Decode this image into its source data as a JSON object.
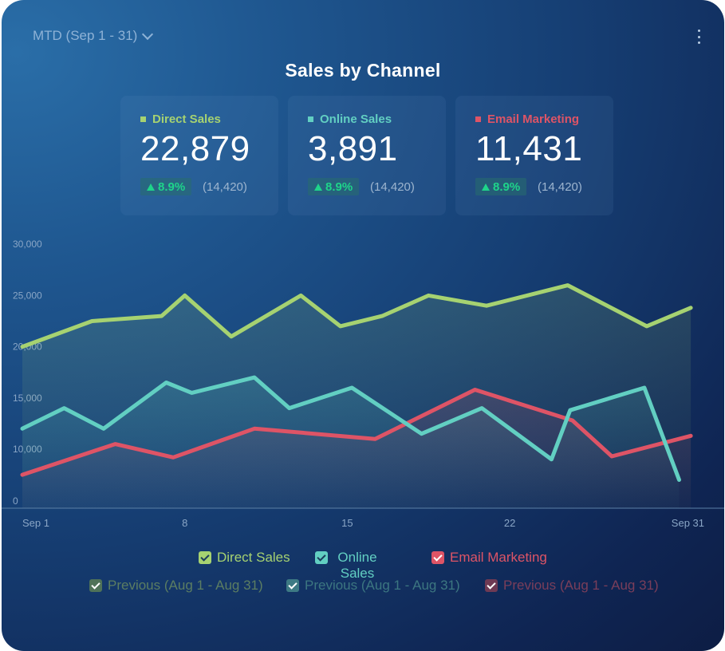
{
  "header": {
    "period_label": "MTD (Sep 1 - 31)",
    "title": "Sales by Channel"
  },
  "colors": {
    "direct": "#a6d271",
    "online": "#62cfc2",
    "email": "#de5466",
    "positive": "#1ed48a"
  },
  "kpis": [
    {
      "label": "Direct Sales",
      "value": "22,879",
      "change": "8.9%",
      "previous": "(14,420)"
    },
    {
      "label": "Online Sales",
      "value": "3,891",
      "change": "8.9%",
      "previous": "(14,420)"
    },
    {
      "label": "Email Marketing",
      "value": "11,431",
      "change": "8.9%",
      "previous": "(14,420)"
    }
  ],
  "legend": {
    "current": [
      "Direct Sales",
      "Online Sales",
      "Email Marketing"
    ],
    "previous": [
      "Previous (Aug 1 - Aug 31)",
      "Previous (Aug 1 - Aug 31)",
      "Previous (Aug 1 - Aug 31)"
    ]
  },
  "chart_data": {
    "type": "line",
    "title": "Sales by Channel",
    "xlabel": "",
    "ylabel": "",
    "x_ticks": [
      "Sep 1",
      "8",
      "15",
      "22",
      "Sep 31"
    ],
    "x_tick_positions": [
      1,
      8,
      15,
      22,
      29
    ],
    "y_ticks": [
      "0",
      "10,000",
      "15,000",
      "20,000",
      "25,000",
      "30,000"
    ],
    "ylim": [
      5000,
      30000
    ],
    "xlim": [
      1,
      29
    ],
    "grid": false,
    "series": [
      {
        "name": "Direct Sales",
        "color": "#a6d271",
        "points": [
          [
            1,
            20000
          ],
          [
            4,
            22500
          ],
          [
            7,
            23000
          ],
          [
            8,
            25000
          ],
          [
            10,
            21000
          ],
          [
            13,
            25000
          ],
          [
            14.7,
            22000
          ],
          [
            16.5,
            23000
          ],
          [
            18.5,
            25000
          ],
          [
            21,
            24000
          ],
          [
            24.5,
            26000
          ],
          [
            27.9,
            22000
          ],
          [
            29.8,
            23800
          ]
        ]
      },
      {
        "name": "Online Sales",
        "color": "#62cfc2",
        "points": [
          [
            1,
            12000
          ],
          [
            2.8,
            14000
          ],
          [
            4.5,
            12000
          ],
          [
            7.2,
            16500
          ],
          [
            8.3,
            15500
          ],
          [
            11,
            17000
          ],
          [
            12.5,
            14000
          ],
          [
            15.2,
            16000
          ],
          [
            18.2,
            11500
          ],
          [
            20.8,
            14000
          ],
          [
            23.8,
            9000
          ],
          [
            24.6,
            13800
          ],
          [
            27.8,
            16000
          ],
          [
            29.3,
            7000
          ]
        ]
      },
      {
        "name": "Email Marketing",
        "color": "#de5466",
        "points": [
          [
            1,
            7500
          ],
          [
            5,
            10500
          ],
          [
            7.5,
            9200
          ],
          [
            11,
            12000
          ],
          [
            16.2,
            11000
          ],
          [
            20.5,
            15800
          ],
          [
            24.7,
            12800
          ],
          [
            26.4,
            9300
          ],
          [
            29.8,
            11300
          ]
        ]
      }
    ]
  }
}
